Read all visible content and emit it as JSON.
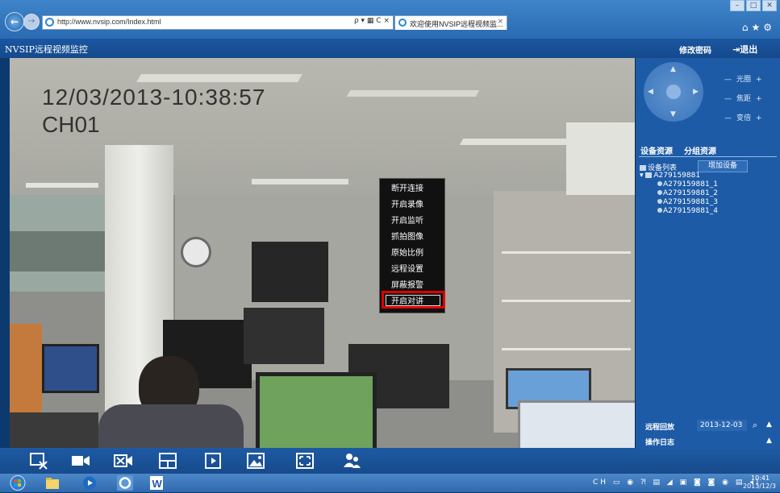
{
  "browser": {
    "url": "http://www.nvsip.com/Index.html",
    "tab_title": "欢迎使用NVSIP远程视频监...",
    "tab_close": "×",
    "addr_tools": "ρ ▾ ▦ C ×"
  },
  "app": {
    "title": "NVSIP远程视频监控",
    "change_password": "修改密码",
    "logout": "⇥退出"
  },
  "video": {
    "timestamp": "12/03/2013-10:38:57",
    "channel": "CH01"
  },
  "context_menu": {
    "items": [
      "断开连接",
      "开启录像",
      "开启监听",
      "抓拍图像",
      "原始比例",
      "远程设置",
      "屏蔽报警",
      "开启对讲"
    ],
    "highlighted_index": 7
  },
  "ptz": {
    "lens": [
      {
        "minus": "—",
        "label": "光圈",
        "plus": "+"
      },
      {
        "minus": "—",
        "label": "焦距",
        "plus": "+"
      },
      {
        "minus": "—",
        "label": "变倍",
        "plus": "+"
      }
    ]
  },
  "resources": {
    "tab_device": "设备资源",
    "tab_group": "分组资源",
    "device_list_label": "设备列表",
    "add_device": "增加设备",
    "device": "A279159881",
    "channels": [
      "A279159881_1",
      "A279159881_2",
      "A279159881_3",
      "A279159881_4"
    ]
  },
  "remote_playback": {
    "label": "远程回放",
    "date": "2013-12-03"
  },
  "ops_log": {
    "label": "操作日志"
  },
  "toolbar": {
    "icons": [
      "close-window-icon",
      "record-icon",
      "close-video-icon",
      "quad-split-icon",
      "play-icon",
      "snapshot-icon",
      "fullscreen-icon",
      "users-icon"
    ]
  },
  "taskbar": {
    "time": "10:41",
    "date": "2013/12/3",
    "tray": "CH ▭ ◉ ⁈ ▤ ◢ ▣ ◙ ◙ ◉ ▤ ◂)"
  }
}
